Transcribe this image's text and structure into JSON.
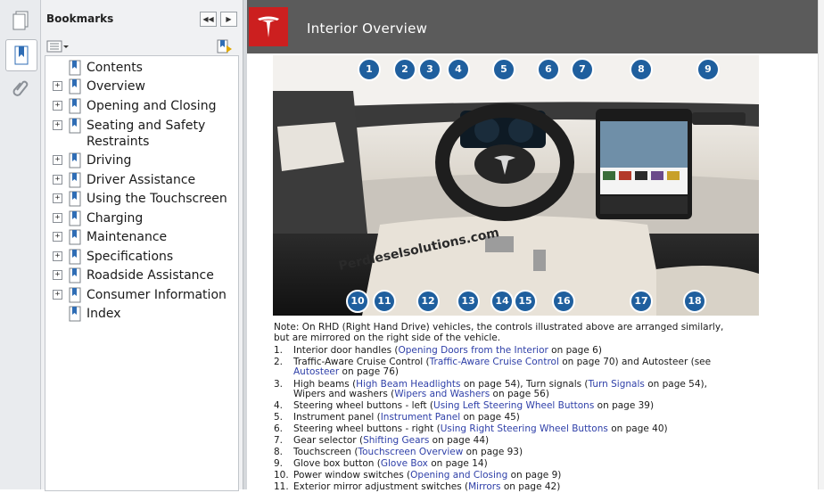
{
  "panel": {
    "title": "Bookmarks",
    "collapse_glyph": "◀◀",
    "expand_glyph": "▶"
  },
  "bookmarks": [
    {
      "label": "Contents",
      "expandable": false
    },
    {
      "label": "Overview",
      "expandable": true
    },
    {
      "label": "Opening and Closing",
      "expandable": true
    },
    {
      "label": "Seating and Safety",
      "label2": "Restraints",
      "expandable": true
    },
    {
      "label": "Driving",
      "expandable": true
    },
    {
      "label": "Driver Assistance",
      "expandable": true
    },
    {
      "label": "Using the Touchscreen",
      "expandable": true
    },
    {
      "label": "Charging",
      "expandable": true
    },
    {
      "label": "Maintenance",
      "expandable": true
    },
    {
      "label": "Specifications",
      "expandable": true
    },
    {
      "label": "Roadside Assistance",
      "expandable": true
    },
    {
      "label": "Consumer Information",
      "expandable": true
    },
    {
      "label": "Index",
      "expandable": false
    }
  ],
  "document": {
    "title": "Interior Overview",
    "brand_color": "#cc1f1f",
    "link_color": "#2e3fa8",
    "callout_color": "#1f5f9e",
    "watermark": "Perdieselsolutions.com",
    "callouts": [
      "1",
      "2",
      "3",
      "4",
      "5",
      "6",
      "7",
      "8",
      "9",
      "10",
      "11",
      "12",
      "13",
      "14",
      "15",
      "16",
      "17",
      "18"
    ],
    "note_line1": "Note: On RHD (Right Hand Drive) vehicles, the controls illustrated above are arranged similarly,",
    "note_line2": "but are mirrored on the right side of the vehicle.",
    "items": [
      {
        "num": "1.",
        "pre": "Interior door handles (",
        "link": "Opening Doors from the Interior",
        "post": " on page 6)"
      },
      {
        "num": "2.",
        "pre": "Traffic-Aware Cruise Control (",
        "link": "Traffic-Aware Cruise Control",
        "post": " on page 70) and Autosteer (see",
        "link2": "Autosteer",
        "post2": " on page 76)"
      },
      {
        "num": "3.",
        "pre": "High beams (",
        "link": "High Beam Headlights",
        "post": " on page 54), Turn signals (",
        "link_b": "Turn Signals",
        "post_b": " on page 54),",
        "pre2": "Wipers and washers (",
        "link2": "Wipers and Washers",
        "post2": " on page 56)"
      },
      {
        "num": "4.",
        "pre": "Steering wheel buttons - left (",
        "link": "Using Left Steering Wheel Buttons",
        "post": " on page 39)"
      },
      {
        "num": "5.",
        "pre": "Instrument panel (",
        "link": "Instrument Panel",
        "post": " on page 45)"
      },
      {
        "num": "6.",
        "pre": "Steering wheel buttons - right (",
        "link": "Using Right Steering Wheel Buttons",
        "post": " on page 40)"
      },
      {
        "num": "7.",
        "pre": "Gear selector (",
        "link": "Shifting Gears",
        "post": " on page 44)"
      },
      {
        "num": "8.",
        "pre": "Touchscreen (",
        "link": "Touchscreen Overview",
        "post": " on page 93)"
      },
      {
        "num": "9.",
        "pre": "Glove box button (",
        "link": "Glove Box",
        "post": " on page 14)"
      },
      {
        "num": "10.",
        "pre": "Power window switches (",
        "link": "Opening and Closing",
        "post": " on page 9)"
      },
      {
        "num": "11.",
        "pre": "Exterior mirror adjustment switches (",
        "link": "Mirrors",
        "post": " on page 42)"
      }
    ]
  }
}
